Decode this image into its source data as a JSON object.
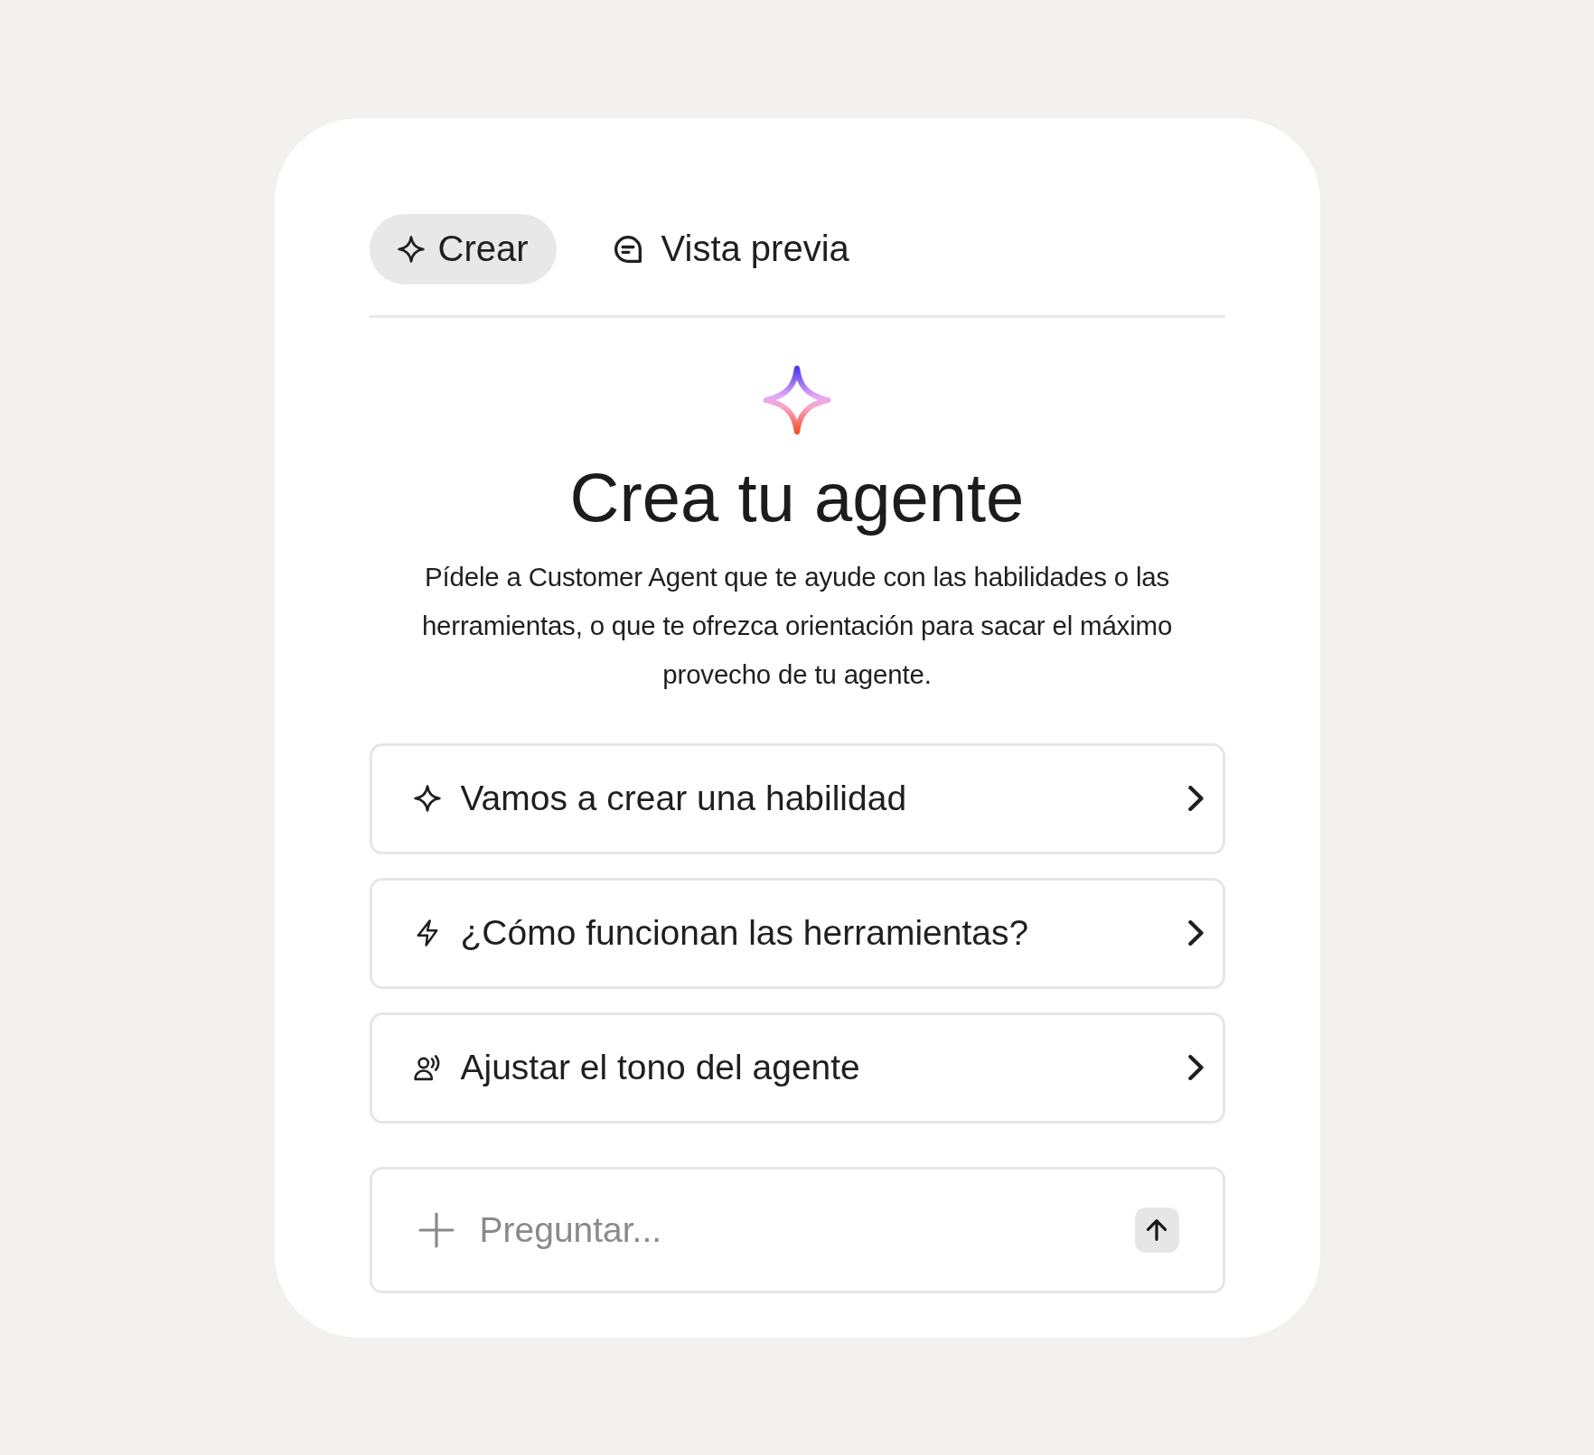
{
  "tabs": [
    {
      "kind": "sparkle",
      "label": "Crear",
      "selected": true
    },
    {
      "kind": "chat",
      "label": "Vista previa",
      "selected": false
    }
  ],
  "hero": {
    "title": "Crea tu agente",
    "description": "Pídele a Customer Agent que te ayude con las habilidades o las herramientas, o que te ofrezca orientación para sacar el máximo provecho de tu agente."
  },
  "suggestions": [
    {
      "kind": "sparkle",
      "label": "Vamos a crear una habilidad"
    },
    {
      "kind": "bolt",
      "label": "¿Cómo funcionan las herramientas?"
    },
    {
      "kind": "voice",
      "label": "Ajustar el tono del agente"
    }
  ],
  "composer": {
    "placeholder": "Preguntar..."
  }
}
